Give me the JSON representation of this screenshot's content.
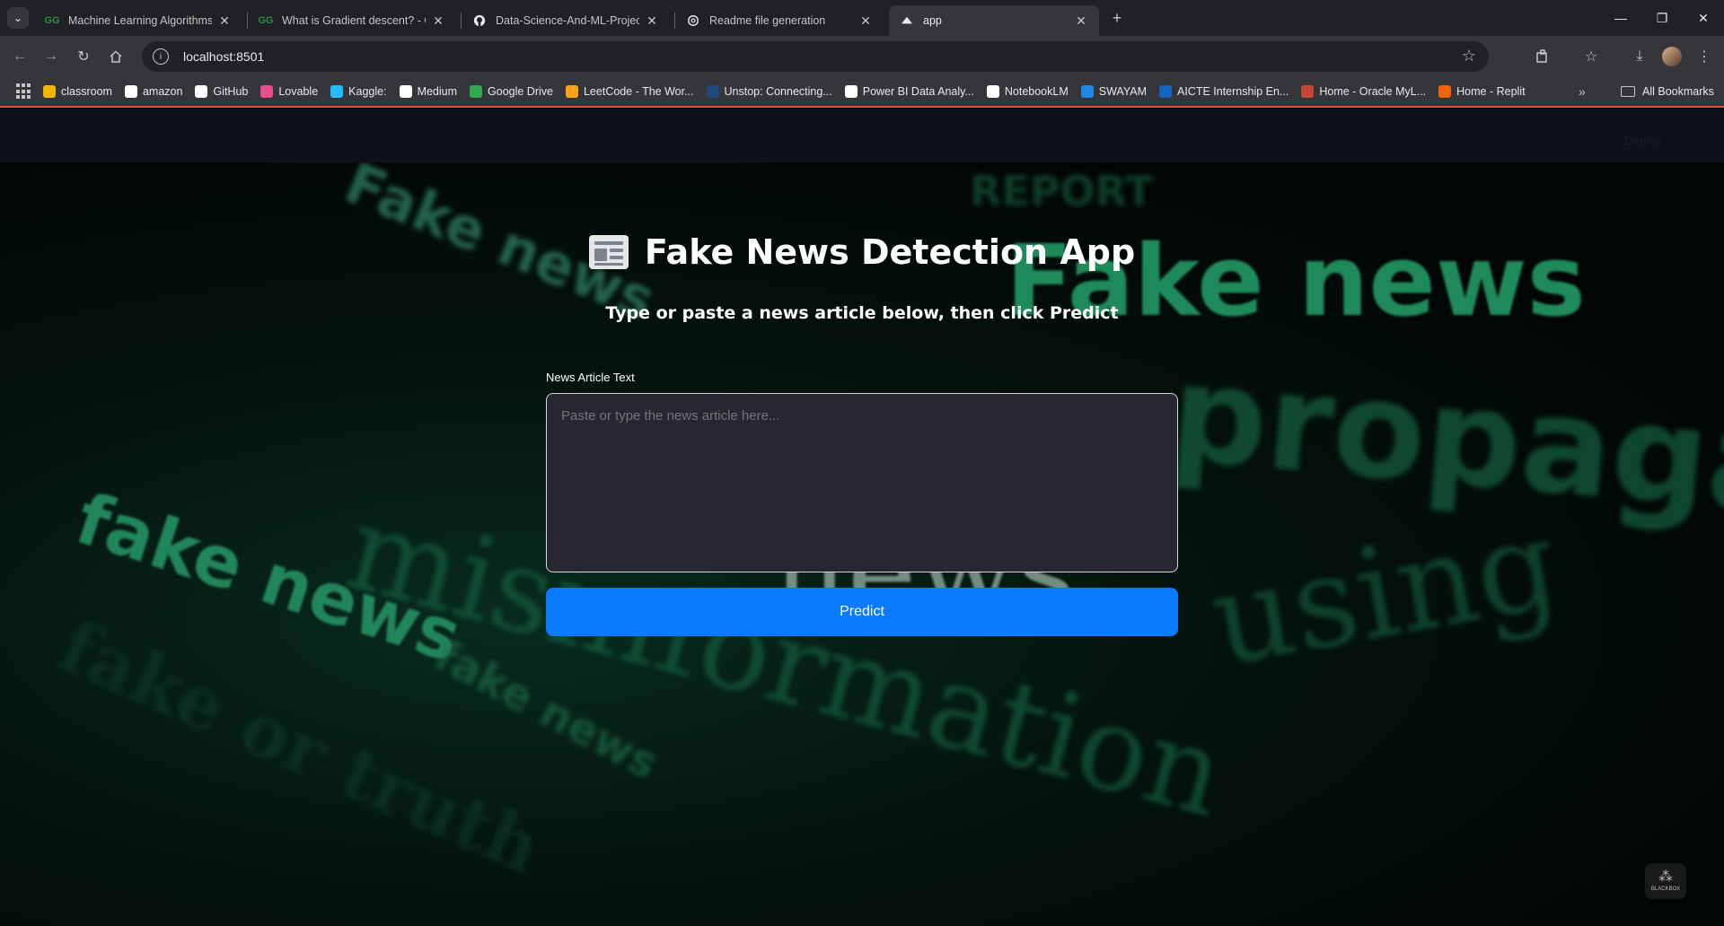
{
  "browser": {
    "tabs": [
      {
        "title": "Machine Learning Algorithms -",
        "favicon": "gfg-icon",
        "active": false
      },
      {
        "title": "What is Gradient descent? - Ge",
        "favicon": "gfg-icon",
        "active": false
      },
      {
        "title": "Data-Science-And-ML-Projects",
        "favicon": "github-icon",
        "active": false
      },
      {
        "title": "Readme file generation",
        "favicon": "chatgpt-icon",
        "active": false
      },
      {
        "title": "app",
        "favicon": "streamlit-icon",
        "active": true
      }
    ],
    "url": "localhost:8501",
    "bookmarks": [
      {
        "label": "classroom",
        "color": "#f4b400"
      },
      {
        "label": "amazon",
        "color": "#ffffff"
      },
      {
        "label": "GitHub",
        "color": "#ffffff"
      },
      {
        "label": "Lovable",
        "color": "#e94f8b"
      },
      {
        "label": "Kaggle:",
        "color": "#20beff"
      },
      {
        "label": "Medium",
        "color": "#ffffff"
      },
      {
        "label": "Google Drive",
        "color": "#34a853"
      },
      {
        "label": "LeetCode - The Wor...",
        "color": "#ffa116"
      },
      {
        "label": "Unstop: Connecting...",
        "color": "#1c4980"
      },
      {
        "label": "Power BI Data Analy...",
        "color": "#ffffff"
      },
      {
        "label": "NotebookLM",
        "color": "#ffffff"
      },
      {
        "label": "SWAYAM",
        "color": "#1e88e5"
      },
      {
        "label": "AICTE Internship En...",
        "color": "#1565c0"
      },
      {
        "label": "Home - Oracle MyL...",
        "color": "#c74634"
      },
      {
        "label": "Home - Replit",
        "color": "#f26207"
      }
    ],
    "all_bookmarks": "All Bookmarks"
  },
  "app": {
    "header": {
      "deploy": "Deploy"
    },
    "title": "Fake News Detection App",
    "subtitle": "Type or paste a news article below, then click Predict",
    "field_label": "News Article Text",
    "textarea_placeholder": "Paste or type the news article here...",
    "predict_label": "Predict",
    "background_words": [
      "Fake news",
      "REPORT",
      "news",
      "fake news",
      "misinformation",
      "propaganda",
      "using"
    ],
    "accent": "#0a7cff",
    "widget_label": "BLACKBOX"
  }
}
